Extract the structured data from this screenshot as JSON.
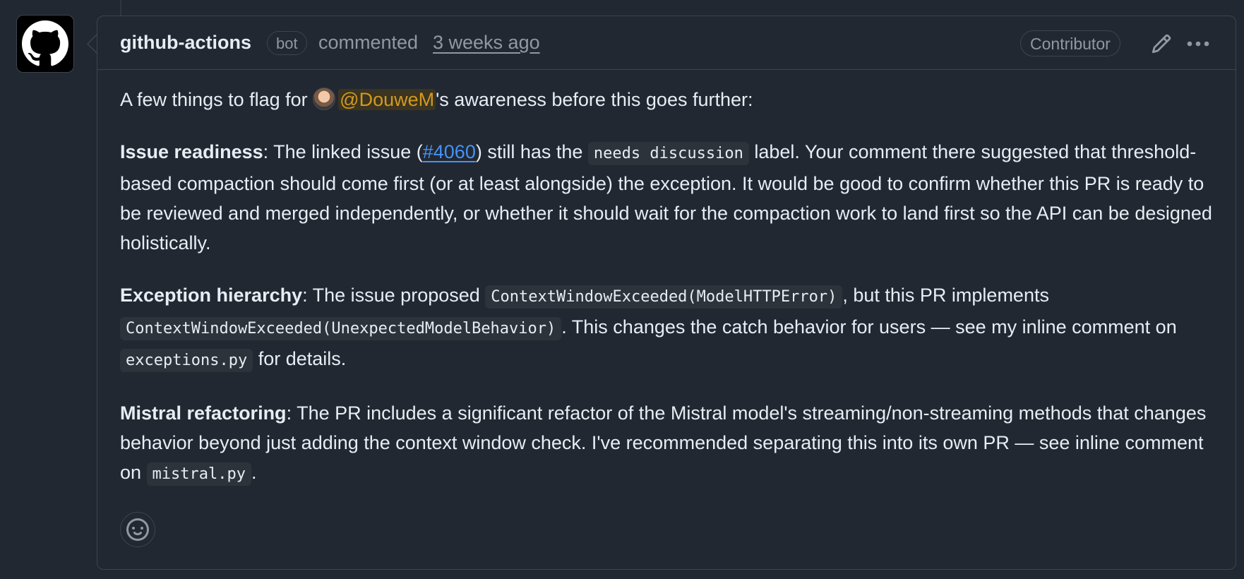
{
  "comment": {
    "author": "github-actions",
    "bot_badge": "bot",
    "action_text": "commented",
    "timestamp": "3 weeks ago",
    "role_badge": "Contributor",
    "icons": {
      "avatar": "github-octocat-icon",
      "edit": "pencil-icon",
      "more": "kebab-horizontal-icon",
      "reaction": "smiley-icon"
    },
    "body": {
      "intro_prefix": "A few things to flag for ",
      "mention": "@DouweM",
      "intro_suffix": "'s awareness before this goes further:",
      "issue_readiness": {
        "heading": "Issue readiness",
        "t1": ": The linked issue (",
        "issue_link": "#4060",
        "t2": ") still has the ",
        "code_label": "needs discussion",
        "t3": " label. Your comment there suggested that threshold-based compaction should come first (or at least alongside) the exception. It would be good to confirm whether this PR is ready to be reviewed and merged independently, or whether it should wait for the compaction work to land first so the API can be designed holistically."
      },
      "exception_hierarchy": {
        "heading": "Exception hierarchy",
        "t1": ": The issue proposed ",
        "code1": "ContextWindowExceeded(ModelHTTPError)",
        "t2": ", but this PR implements ",
        "code2": "ContextWindowExceeded(UnexpectedModelBehavior)",
        "t3": ". This changes the catch behavior for users — see my inline comment on ",
        "code3": "exceptions.py",
        "t4": " for details."
      },
      "mistral_refactoring": {
        "heading": "Mistral refactoring",
        "t1": ": The PR includes a significant refactor of the Mistral model's streaming/non-streaming methods that changes behavior beyond just adding the context window check. I've recommended separating this into its own PR — see inline comment on ",
        "code1": "mistral.py",
        "t2": "."
      }
    }
  },
  "colors": {
    "background": "#222831",
    "border": "#3d444d",
    "muted_text": "#9198a1",
    "mention": "#d29922",
    "link": "#4493f8"
  }
}
